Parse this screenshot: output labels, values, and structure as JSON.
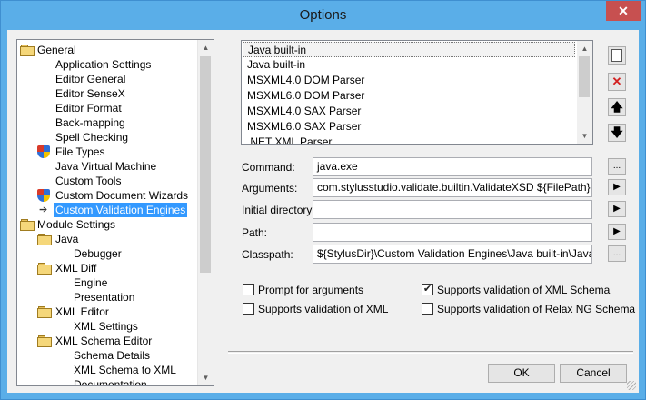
{
  "window": {
    "title": "Options",
    "close_glyph": "✕"
  },
  "tree": {
    "items": [
      {
        "label": "General",
        "icon": "folder-icon",
        "level": 0
      },
      {
        "label": "Application Settings",
        "icon": "none",
        "level": 1
      },
      {
        "label": "Editor General",
        "icon": "none",
        "level": 1
      },
      {
        "label": "Editor SenseX",
        "icon": "none",
        "level": 1
      },
      {
        "label": "Editor Format",
        "icon": "none",
        "level": 1
      },
      {
        "label": "Back-mapping",
        "icon": "none",
        "level": 1
      },
      {
        "label": "Spell Checking",
        "icon": "none",
        "level": 1
      },
      {
        "label": "File Types",
        "icon": "shield-icon",
        "level": 1
      },
      {
        "label": "Java Virtual Machine",
        "icon": "none",
        "level": 1
      },
      {
        "label": "Custom Tools",
        "icon": "none",
        "level": 1
      },
      {
        "label": "Custom Document Wizards",
        "icon": "shield-icon",
        "level": 1
      },
      {
        "label": "Custom Validation Engines",
        "icon": "arrow-icon",
        "level": 1,
        "selected": true
      },
      {
        "label": "Module Settings",
        "icon": "folder-icon",
        "level": 0
      },
      {
        "label": "Java",
        "icon": "folder-icon",
        "level": 1
      },
      {
        "label": "Debugger",
        "icon": "none",
        "level": 2
      },
      {
        "label": "XML Diff",
        "icon": "folder-icon",
        "level": 1
      },
      {
        "label": "Engine",
        "icon": "none",
        "level": 2
      },
      {
        "label": "Presentation",
        "icon": "none",
        "level": 2
      },
      {
        "label": "XML Editor",
        "icon": "folder-icon",
        "level": 1
      },
      {
        "label": "XML Settings",
        "icon": "none",
        "level": 2
      },
      {
        "label": "XML Schema Editor",
        "icon": "folder-icon",
        "level": 1
      },
      {
        "label": "Schema Details",
        "icon": "none",
        "level": 2
      },
      {
        "label": "XML Schema to XML",
        "icon": "none",
        "level": 2
      },
      {
        "label": "Documentation",
        "icon": "none",
        "level": 2
      }
    ]
  },
  "engines": {
    "items": [
      "Java built-in",
      "Java built-in",
      "MSXML4.0 DOM Parser",
      "MSXML6.0 DOM Parser",
      "MSXML4.0 SAX Parser",
      "MSXML6.0 SAX Parser",
      ".NET XML Parser"
    ],
    "buttons": {
      "new": "new-icon",
      "delete": "delete-icon",
      "up": "move-up-icon",
      "down": "move-down-icon"
    }
  },
  "form": {
    "command": {
      "label": "Command:",
      "value": "java.exe"
    },
    "arguments": {
      "label": "Arguments:",
      "value": "com.stylusstudio.validate.builtin.ValidateXSD ${FilePath}"
    },
    "initial_directory": {
      "label": "Initial directory:",
      "value": ""
    },
    "path": {
      "label": "Path:",
      "value": ""
    },
    "classpath": {
      "label": "Classpath:",
      "value": "${StylusDir}\\Custom Validation Engines\\Java built-in\\JavaBuiltin"
    },
    "browse": "...",
    "play": "▶"
  },
  "options": {
    "prompt": {
      "label": "Prompt for arguments",
      "checked": false
    },
    "xml": {
      "label": "Supports validation of XML",
      "checked": false
    },
    "xml_schema": {
      "label": "Supports validation of XML Schema",
      "checked": true
    },
    "relax_ng": {
      "label": "Supports validation of Relax NG Schema",
      "checked": false
    }
  },
  "buttons": {
    "ok": "OK",
    "cancel": "Cancel"
  }
}
